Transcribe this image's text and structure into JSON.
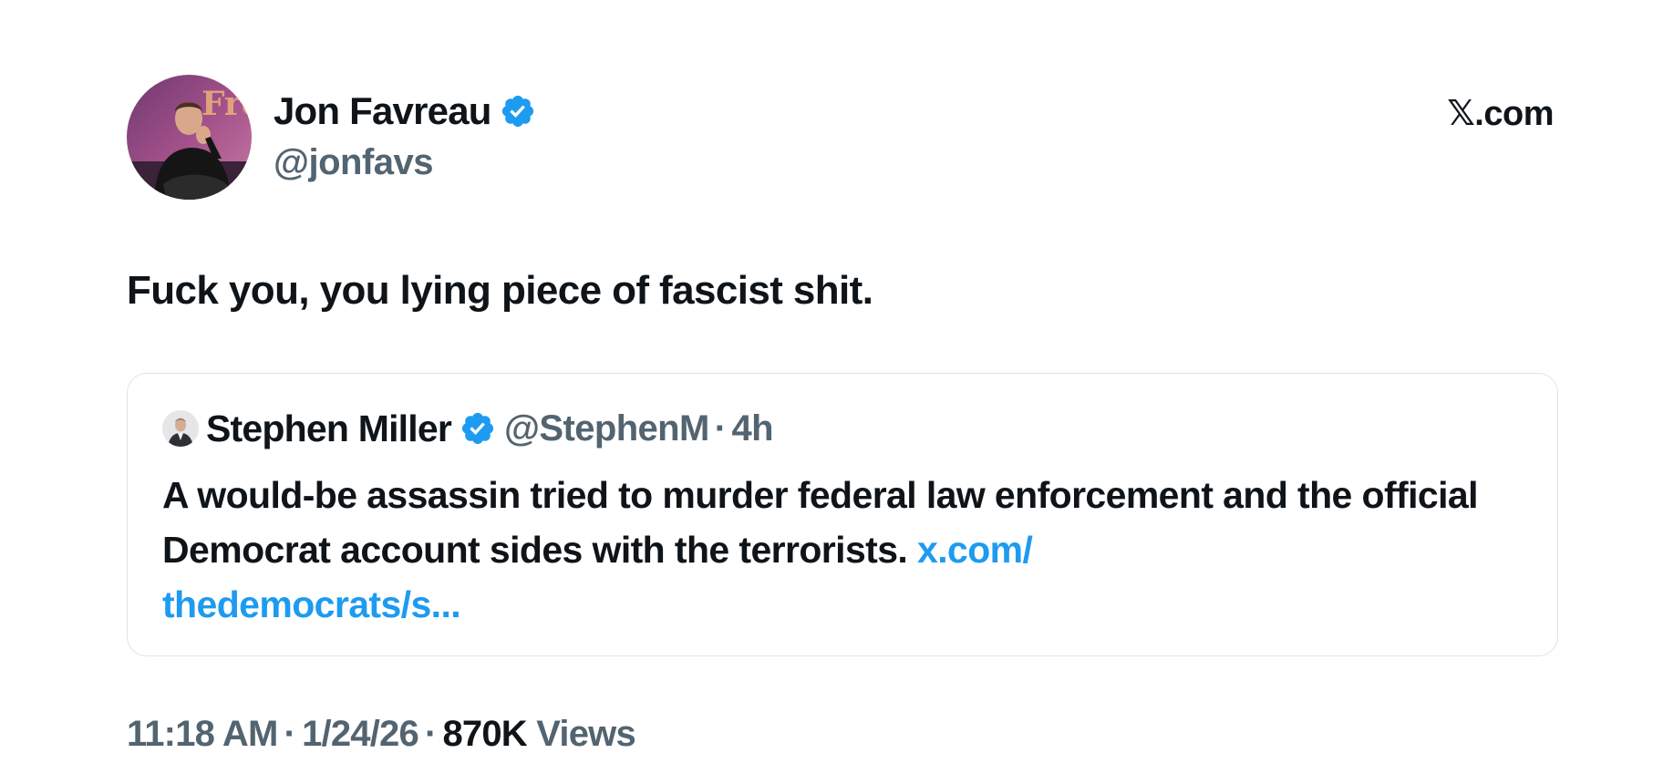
{
  "brand": "𝕏.com",
  "author": {
    "name": "Jon Favreau",
    "handle": "@jonfavs",
    "verified": true,
    "avatar_icon": "profile-photo"
  },
  "tweet": {
    "text": "Fuck you, you lying piece of fascist shit."
  },
  "quoted_tweet": {
    "author_name": "Stephen Miller",
    "author_handle": "@StephenM",
    "separator": "·",
    "time": "4h",
    "verified": true,
    "text": "A would-be assassin tried to murder federal law enforcement and the official Democrat account sides with the terrorists. ",
    "link_part1": "x.com/",
    "link_part2": "thedemocrats/s..."
  },
  "meta": {
    "time": "11:18 AM",
    "separator": "·",
    "date": "1/24/26",
    "views_count": "870K",
    "views_label": "Views"
  },
  "colors": {
    "verified_blue": "#1d9bf0",
    "secondary_text": "#536471",
    "primary_text": "#0f1419",
    "link": "#1d9bf0",
    "border": "#dfe3e7"
  }
}
